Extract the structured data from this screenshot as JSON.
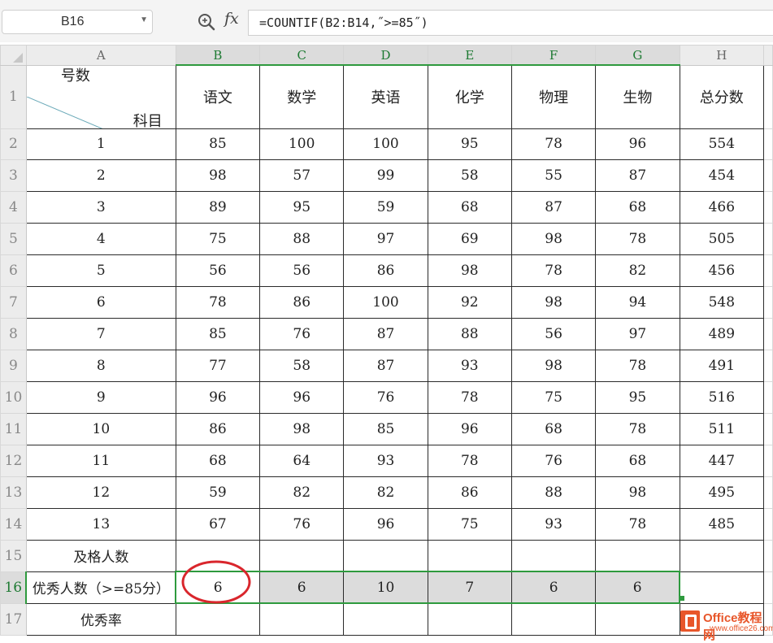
{
  "namebox": {
    "value": "B16"
  },
  "formula": {
    "value": "=COUNTIF(B2:B14,˝>=85˝)"
  },
  "icons": {
    "zoom": "zoom-search-icon",
    "fx": "fx"
  },
  "columns": [
    "A",
    "B",
    "C",
    "D",
    "E",
    "F",
    "G",
    "H"
  ],
  "row_numbers": [
    "1",
    "2",
    "3",
    "4",
    "5",
    "6",
    "7",
    "8",
    "9",
    "10",
    "11",
    "12",
    "13",
    "14",
    "15",
    "16",
    "17"
  ],
  "header": {
    "corner_top": "科目",
    "corner_bottom": "号数",
    "subjects": [
      "语文",
      "数学",
      "英语",
      "化学",
      "物理",
      "生物"
    ],
    "total": "总分数"
  },
  "rows": [
    {
      "id": "1",
      "scores": [
        "85",
        "100",
        "100",
        "95",
        "78",
        "96"
      ],
      "total": "554"
    },
    {
      "id": "2",
      "scores": [
        "98",
        "57",
        "99",
        "58",
        "55",
        "87"
      ],
      "total": "454"
    },
    {
      "id": "3",
      "scores": [
        "89",
        "95",
        "59",
        "68",
        "87",
        "68"
      ],
      "total": "466"
    },
    {
      "id": "4",
      "scores": [
        "75",
        "88",
        "97",
        "69",
        "98",
        "78"
      ],
      "total": "505"
    },
    {
      "id": "5",
      "scores": [
        "56",
        "56",
        "86",
        "98",
        "78",
        "82"
      ],
      "total": "456"
    },
    {
      "id": "6",
      "scores": [
        "78",
        "86",
        "100",
        "92",
        "98",
        "94"
      ],
      "total": "548"
    },
    {
      "id": "7",
      "scores": [
        "85",
        "76",
        "87",
        "88",
        "56",
        "97"
      ],
      "total": "489"
    },
    {
      "id": "8",
      "scores": [
        "77",
        "58",
        "87",
        "93",
        "98",
        "78"
      ],
      "total": "491"
    },
    {
      "id": "9",
      "scores": [
        "96",
        "96",
        "76",
        "78",
        "75",
        "95"
      ],
      "total": "516"
    },
    {
      "id": "10",
      "scores": [
        "86",
        "98",
        "85",
        "96",
        "68",
        "78"
      ],
      "total": "511"
    },
    {
      "id": "11",
      "scores": [
        "68",
        "64",
        "93",
        "78",
        "76",
        "68"
      ],
      "total": "447"
    },
    {
      "id": "12",
      "scores": [
        "59",
        "82",
        "82",
        "86",
        "88",
        "98"
      ],
      "total": "495"
    },
    {
      "id": "13",
      "scores": [
        "67",
        "76",
        "96",
        "75",
        "93",
        "78"
      ],
      "total": "485"
    }
  ],
  "summary": {
    "pass_label": "及格人数",
    "excellent_label": "优秀人数（>=85分）",
    "excellent_values": [
      "6",
      "6",
      "10",
      "7",
      "6",
      "6"
    ],
    "rate_label": "优秀率"
  },
  "watermark": {
    "line1": "Office教程网",
    "line2": "www.office26.com"
  },
  "colors": {
    "selection": "#2e9a3e",
    "annotation_circle": "#d9262c",
    "brand": "#e8562a"
  }
}
